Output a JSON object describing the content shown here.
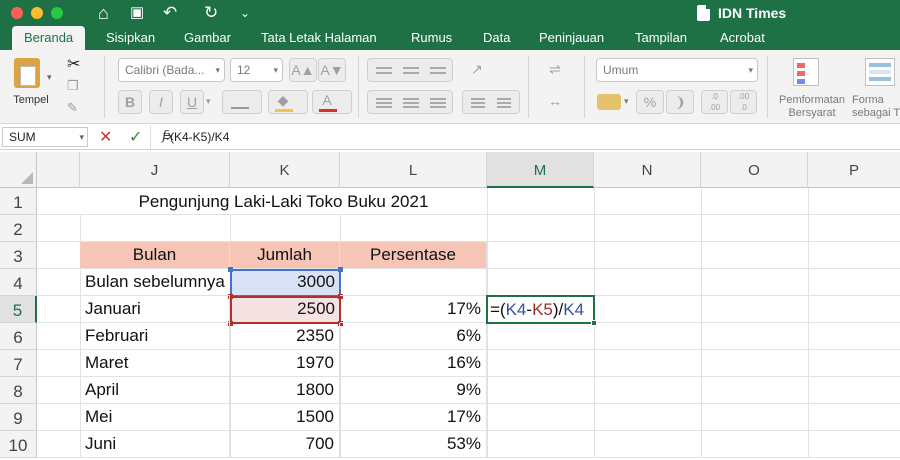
{
  "titlebar": {
    "app_title": "IDN Times",
    "colors": {
      "close": "#fe5f57",
      "minimize": "#febc2e",
      "maximize": "#28c840"
    }
  },
  "quick_access": {
    "home_icon": "⌂",
    "save_icon": "▣",
    "undo_icon": "↶",
    "redo_icon": "↻",
    "more_icon": "⌄"
  },
  "ribbon_tabs": [
    "Beranda",
    "Sisipkan",
    "Gambar",
    "Tata Letak Halaman",
    "Rumus",
    "Data",
    "Peninjauan",
    "Tampilan",
    "Acrobat"
  ],
  "ribbon": {
    "paste_label": "Tempel",
    "font_name": "Calibri (Bada...",
    "font_size": "12",
    "grow_font": "A▲",
    "shrink_font": "A▼",
    "bold": "B",
    "italic": "I",
    "underline": "U",
    "number_format": "Umum",
    "percent": "%",
    "conditional_formatting": "Pemformatan\nBersyarat",
    "format_as_table": "Forma\nsebagai T"
  },
  "formula_bar": {
    "name_box": "SUM",
    "cancel_icon": "✕",
    "enter_icon": "✓",
    "fx": "fx",
    "formula": "=(K4-K5)/K4"
  },
  "columns": [
    "J",
    "K",
    "L",
    "M",
    "N",
    "O",
    "P"
  ],
  "rows": [
    "1",
    "2",
    "3",
    "4",
    "5",
    "6",
    "7",
    "8",
    "9",
    "10"
  ],
  "sheet": {
    "title": "Pengunjung Laki-Laki Toko Buku 2021",
    "headers": {
      "bulan": "Bulan",
      "jumlah": "Jumlah",
      "persentase": "Persentase"
    },
    "data": [
      {
        "bulan": "Bulan sebelumnya",
        "jumlah": "3000",
        "persentase": ""
      },
      {
        "bulan": "Januari",
        "jumlah": "2500",
        "persentase": "17%"
      },
      {
        "bulan": "Februari",
        "jumlah": "2350",
        "persentase": "6%"
      },
      {
        "bulan": "Maret",
        "jumlah": "1970",
        "persentase": "16%"
      },
      {
        "bulan": "April",
        "jumlah": "1800",
        "persentase": "9%"
      },
      {
        "bulan": "Mei",
        "jumlah": "1500",
        "persentase": "17%"
      },
      {
        "bulan": "Juni",
        "jumlah": "700",
        "persentase": "53%"
      }
    ],
    "editing": {
      "prefix": "=(",
      "ref1": "K4",
      "minus": "-",
      "ref2": "K5",
      "mid": ")/",
      "ref3": "K4"
    },
    "colors": {
      "header_fill": "#f6c5b6",
      "ref_blue": "#2f5597",
      "ref_red": "#9b2c2c",
      "accent": "#1e7145"
    }
  }
}
